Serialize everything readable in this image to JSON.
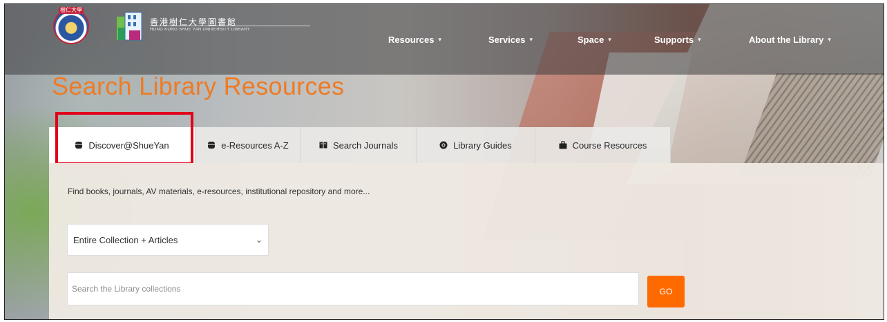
{
  "header": {
    "logo_top": "樹仁大學",
    "library_name_zh": "香港樹仁大學圖書館",
    "library_name_en": "HONG KONG SHUE YAN UNIVERSITY LIBRARY",
    "nav": [
      {
        "label": "Resources"
      },
      {
        "label": "Services"
      },
      {
        "label": "Space"
      },
      {
        "label": "Supports"
      },
      {
        "label": "About the Library"
      }
    ]
  },
  "page_title": "Search Library Resources",
  "tabs": [
    {
      "label": "Discover@ShueYan",
      "icon": "database-icon",
      "active": true
    },
    {
      "label": "e-Resources A-Z",
      "icon": "database-icon"
    },
    {
      "label": "Search Journals",
      "icon": "journal-icon"
    },
    {
      "label": "Library Guides",
      "icon": "globe-icon"
    },
    {
      "label": "Course Resources",
      "icon": "briefcase-icon"
    }
  ],
  "panel": {
    "description": "Find books, journals, AV materials, e-resources, institutional repository and more...",
    "collection_select": "Entire Collection + Articles",
    "search_placeholder": "Search the Library collections",
    "go_label": "GO"
  },
  "colors": {
    "accent": "#ee7b25",
    "go_button": "#ff6a00",
    "highlight": "#e0001b"
  }
}
